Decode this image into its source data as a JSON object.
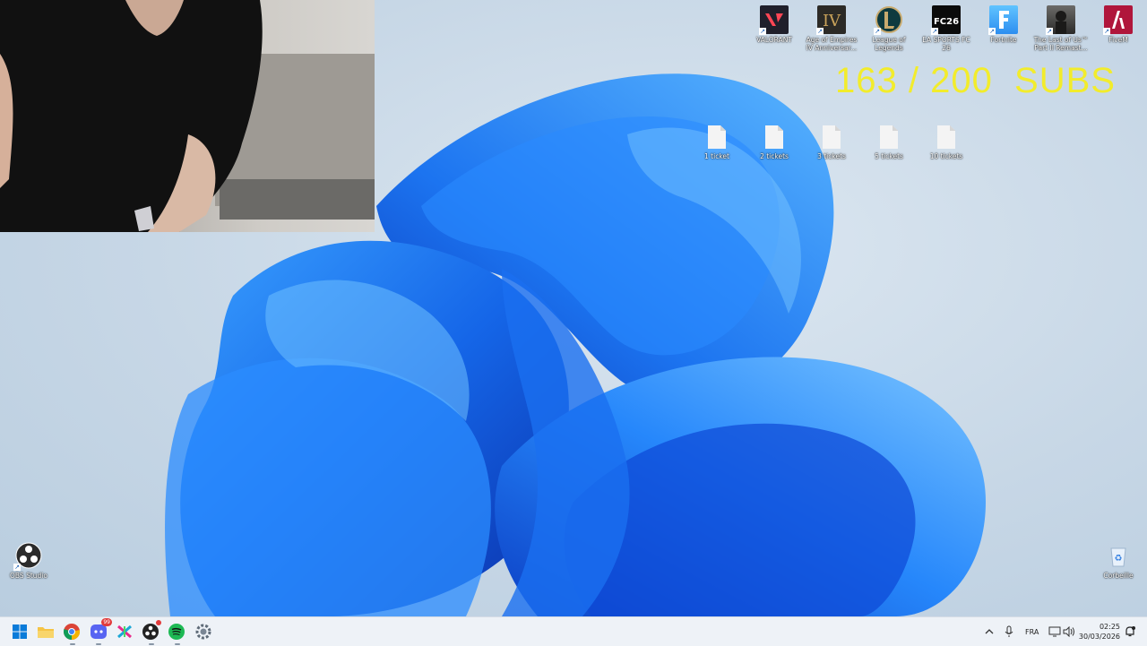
{
  "overlay": {
    "sub_counter": "163 / 200  SUBS"
  },
  "desktop_top_icons": [
    {
      "label": "VALORANT",
      "color": "#1f1f2b",
      "icon": "valorant-icon"
    },
    {
      "label": "Age of Empires IV Anniversar...",
      "color": "#2c2a26",
      "icon": "aoe-icon"
    },
    {
      "label": "League of Legends",
      "color": "#0e3a3f",
      "icon": "lol-icon"
    },
    {
      "label": "EA SPORTS FC 26",
      "color": "#0b0b0b",
      "icon": "fc-icon"
    },
    {
      "label": "Fortnite",
      "color": "#3da2f5",
      "icon": "fortnite-icon"
    },
    {
      "label": "The Last of Us™ Part II Remast...",
      "color": "#3b3a38",
      "icon": "tlou-icon"
    },
    {
      "label": "FiveM",
      "color": "#b0163b",
      "icon": "fivem-icon"
    }
  ],
  "desktop_files": [
    {
      "label": "1 ticket"
    },
    {
      "label": "2 tickets"
    },
    {
      "label": "3 tickets"
    },
    {
      "label": "5 tickets"
    },
    {
      "label": "10 tickets"
    }
  ],
  "desktop_left_icons": [
    {
      "label": "OBS Studio"
    }
  ],
  "desktop_right_icons": [
    {
      "label": "Corbeille"
    }
  ],
  "taskbar": {
    "apps": [
      "start-icon",
      "file-explorer-icon",
      "chrome-icon",
      "discord-icon",
      "capcut-icon",
      "obs-icon",
      "spotify-icon",
      "settings-icon"
    ],
    "discord_badge": "99",
    "language": "FRA",
    "time": "02:25",
    "date": "30/03/2026"
  },
  "colors": {
    "accent": "#0a5ad9",
    "counter": "#f2ec2c",
    "taskbar": "#eef2f7"
  }
}
